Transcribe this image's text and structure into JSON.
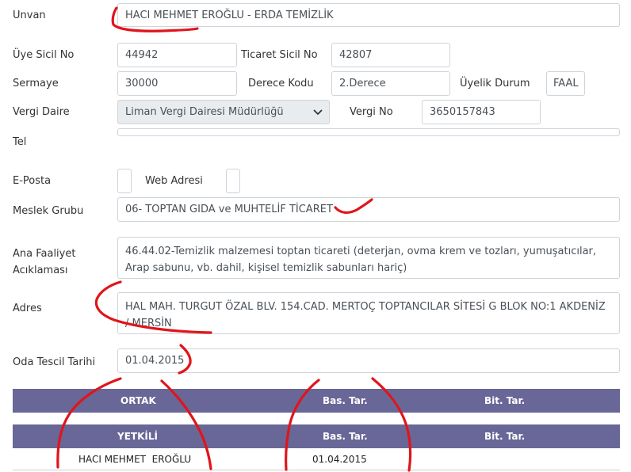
{
  "fields": {
    "unvan": {
      "label": "Unvan",
      "value": "HACI MEHMET EROĞLU - ERDA TEMİZLİK"
    },
    "uye_sicil": {
      "label": "Üye Sicil No",
      "value": "44942"
    },
    "ticaret_sicil": {
      "label": "Ticaret Sicil No",
      "value": "42807"
    },
    "sermaye": {
      "label": "Sermaye",
      "value": "30000"
    },
    "derece_kodu": {
      "label": "Derece Kodu",
      "value": "2.Derece"
    },
    "uyelik_durum": {
      "label": "Üyelik Durum",
      "value": "FAAL"
    },
    "vergi_daire": {
      "label": "Vergi Daire",
      "value": "Liman Vergi Dairesi Müdürlüğü"
    },
    "vergi_no": {
      "label": "Vergi No",
      "value": "3650157843"
    },
    "tel": {
      "label": "Tel",
      "value": ""
    },
    "eposta": {
      "label": "E-Posta",
      "value": ""
    },
    "web_adresi": {
      "label": "Web Adresi",
      "value": ""
    },
    "meslek_grubu": {
      "label": "Meslek Grubu",
      "value": "06- TOPTAN GIDA ve MUHTELİF TİCARET"
    },
    "ana_faaliyet": {
      "label_line1": "Ana Faaliyet",
      "label_line2": "Acıklaması",
      "value": "46.44.02-Temizlik malzemesi toptan ticareti (deterjan, ovma krem ve tozları, yumuşatıcılar, Arap sabunu, vb. dahil, kişisel temizlik sabunları hariç)"
    },
    "adres": {
      "label": "Adres",
      "value": "HAL MAH. TURGUT ÖZAL BLV. 154.CAD. MERTOÇ TOPTANCILAR SİTESİ G BLOK NO:1 AKDENİZ / MERSİN"
    },
    "oda_tescil": {
      "label": "Oda Tescil Tarihi",
      "value": "01.04.2015"
    }
  },
  "ortak_table": {
    "headers": [
      "ORTAK",
      "Bas. Tar.",
      "Bit. Tar."
    ]
  },
  "yetkili_table": {
    "headers": [
      "YETKİLİ",
      "Bas. Tar.",
      "Bit. Tar."
    ],
    "rows": [
      {
        "name": "HACI MEHMET  EROĞLU",
        "bas_tar": "01.04.2015",
        "bit_tar": ""
      }
    ]
  },
  "colors": {
    "table_header": "#696797",
    "annotation_ink": "#e0151b",
    "field_border": "#ced4da",
    "select_bg": "#e9ecef"
  },
  "icons": {
    "select_arrow": "chevron-down-icon"
  }
}
